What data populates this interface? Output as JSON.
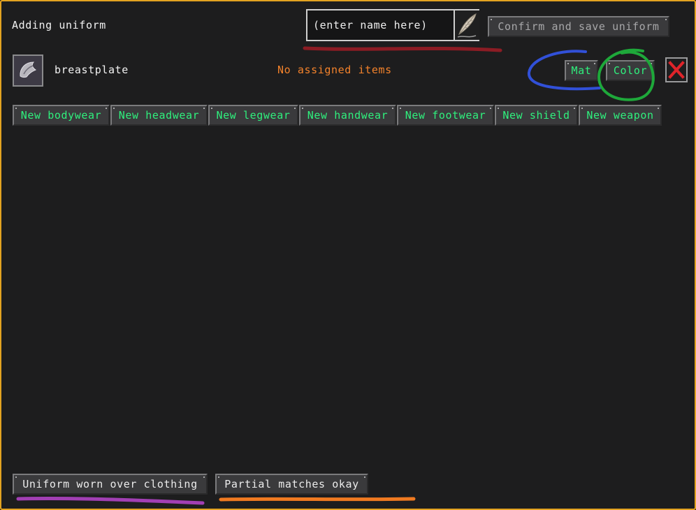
{
  "header": {
    "title": "Adding uniform",
    "name_placeholder": "(enter name here)",
    "confirm_label": "Confirm and save uniform"
  },
  "item_row": {
    "name": "breastplate",
    "status": "No assigned items",
    "mat_label": "Mat",
    "color_label": "Color"
  },
  "categories": [
    "New bodywear",
    "New headwear",
    "New legwear",
    "New handwear",
    "New footwear",
    "New shield",
    "New weapon"
  ],
  "footer": {
    "over_clothing_label": "Uniform worn over clothing",
    "partial_label": "Partial matches okay"
  },
  "colors": {
    "frame_border": "#e3a321",
    "green_text": "#2ff07d",
    "orange_text": "#f3822b",
    "annotation_red": "#8c1c24",
    "annotation_blue": "#3150d8",
    "annotation_green": "#1ea83a",
    "annotation_purple": "#a23fb4",
    "annotation_orange": "#f07a21"
  },
  "icons": [
    "feather-quill-icon",
    "breastplate-icon",
    "red-x-close-icon"
  ]
}
